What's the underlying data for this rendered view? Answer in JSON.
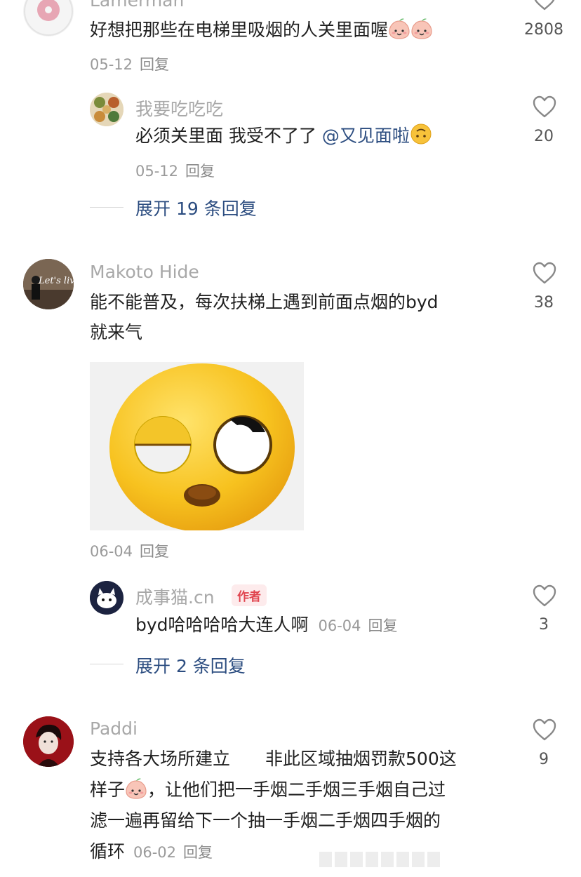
{
  "comments": [
    {
      "username": "Lamerman",
      "text": "好想把那些在电梯里吸烟的人关里面喔",
      "date": "05-12",
      "reply_label": "回复",
      "likes": "2808",
      "replies": [
        {
          "username": "我要吃吃吃",
          "text": "必须关里面 我受不了了",
          "mention": "@又见面啦",
          "date": "05-12",
          "reply_label": "回复",
          "likes": "20"
        }
      ],
      "expand_label": "展开 19 条回复"
    },
    {
      "username": "Makoto Hide",
      "avatar_text": "Let's live",
      "text_lines": [
        "能不能普及，每次扶梯上遇到前面点烟的byd",
        "就来气"
      ],
      "date": "06-04",
      "reply_label": "回复",
      "likes": "38",
      "replies": [
        {
          "username": "成事猫.cn",
          "author_tag": "作者",
          "text": "byd哈哈哈哈大连人啊",
          "date": "06-04",
          "reply_label": "回复",
          "likes": "3"
        }
      ],
      "expand_label": "展开 2 条回复"
    },
    {
      "username": "Paddi",
      "text_lines": [
        "支持各大场所建立　　非此区域抽烟罚款500这",
        "样子",
        "，让他们把一手烟二手烟三手烟自己过",
        "滤一遍再留给下一个抽一手烟二手烟四手烟的",
        "循环"
      ],
      "date": "06-02",
      "reply_label": "回复",
      "likes": "9"
    }
  ],
  "colors": {
    "link": "#2c4d80",
    "author_tag_bg": "#fdebec",
    "author_tag_text": "#e0454f",
    "muted": "#a8a8a8"
  },
  "icons": [
    "heart-outline-icon",
    "smiling-peach-emoji",
    "upside-down-face-emoji",
    "rolling-eyes-face-sticker"
  ]
}
